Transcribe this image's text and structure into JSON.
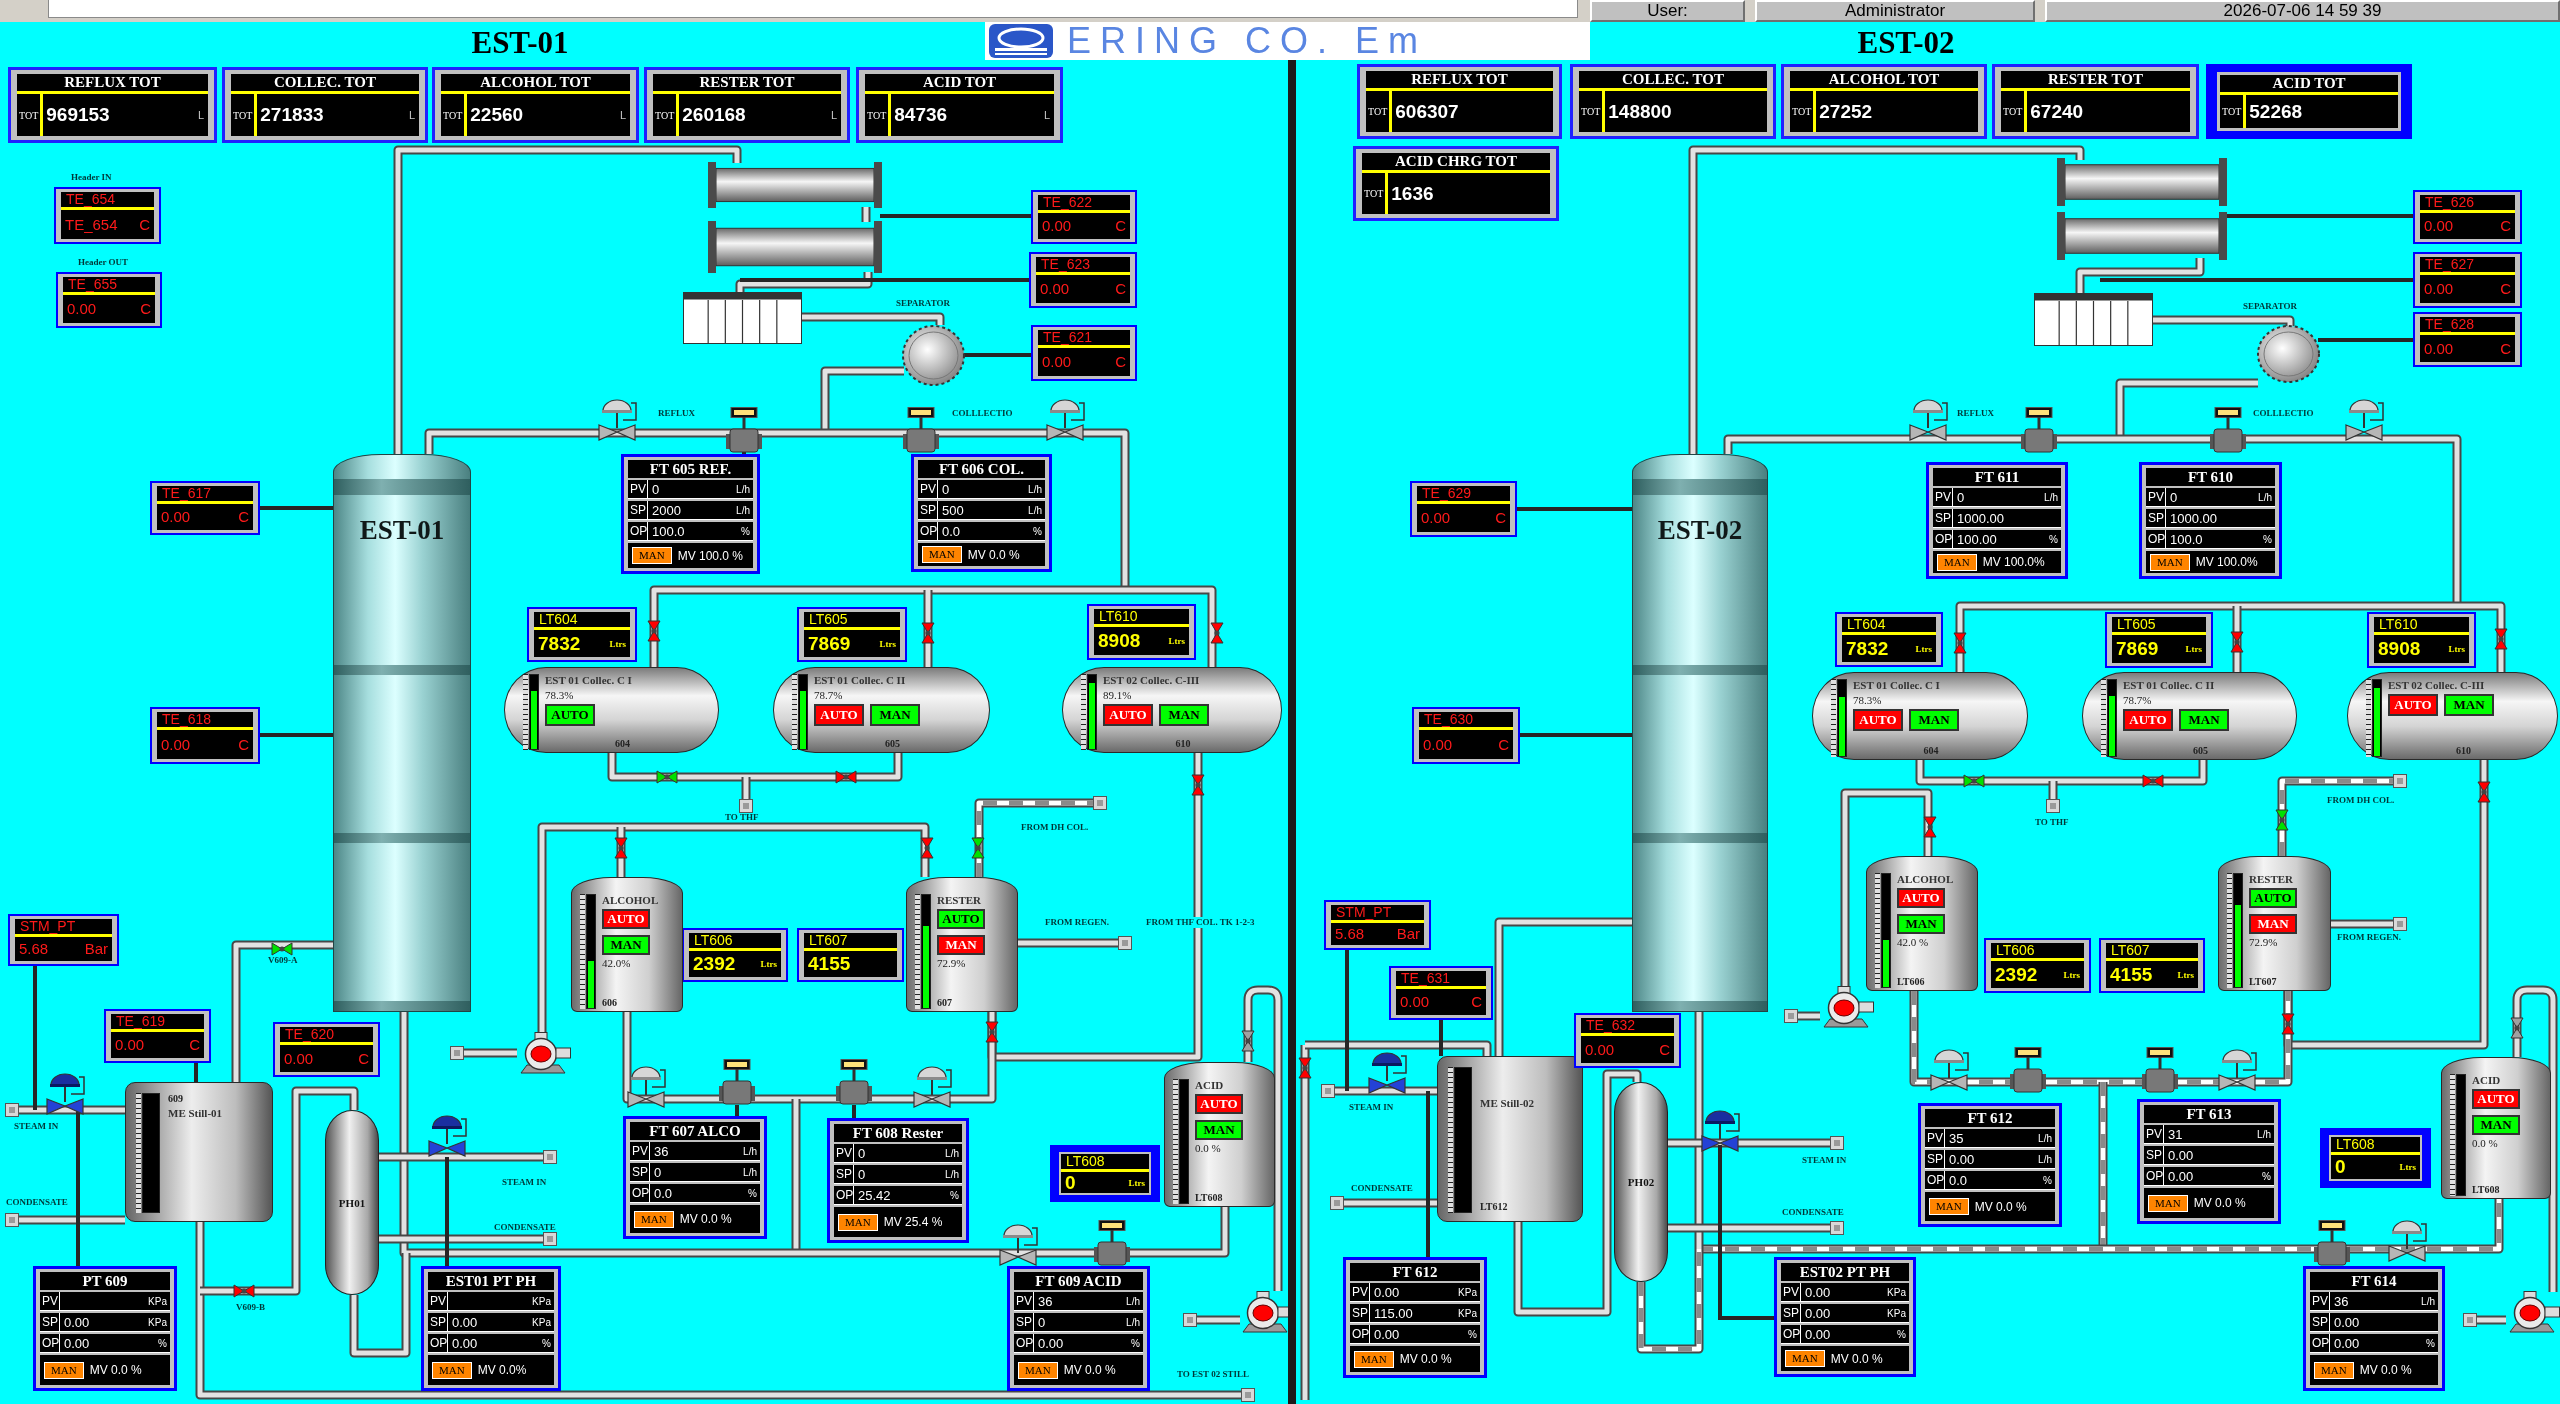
{
  "top_bar": {
    "user_label": "User:",
    "user": "Administrator",
    "datetime": "2026-07-06 14 59 39"
  },
  "logo": {
    "text": "ERING CO. Em"
  },
  "sections": [
    {
      "title": "EST-01",
      "totalizers": [
        {
          "title": "REFLUX TOT",
          "label": "TOT",
          "value": "969153",
          "unit": "L",
          "highlighted": false
        },
        {
          "title": "COLLEC. TOT",
          "label": "TOT",
          "value": "271833",
          "unit": "L",
          "highlighted": false
        },
        {
          "title": "ALCOHOL TOT",
          "label": "TOT",
          "value": "22560",
          "unit": "L",
          "highlighted": false
        },
        {
          "title": "RESTER TOT",
          "label": "TOT",
          "value": "260168",
          "unit": "L",
          "highlighted": false
        },
        {
          "title": "ACID TOT",
          "label": "TOT",
          "value": "84736",
          "unit": "L",
          "highlighted": false
        }
      ],
      "temperatures": [
        {
          "tag": "TE_654",
          "reading": "TE_654",
          "unit": "C"
        },
        {
          "tag": "TE_655",
          "reading": "0.00",
          "unit": "C"
        },
        {
          "tag": "TE_622",
          "reading": "0.00",
          "unit": "C"
        },
        {
          "tag": "TE_623",
          "reading": "0.00",
          "unit": "C"
        },
        {
          "tag": "TE_621",
          "reading": "0.00",
          "unit": "C"
        },
        {
          "tag": "TE_617",
          "reading": "0.00",
          "unit": "C"
        },
        {
          "tag": "TE_618",
          "reading": "0.00",
          "unit": "C"
        },
        {
          "tag": "STM_PT",
          "reading": "5.68",
          "unit": "Bar"
        },
        {
          "tag": "TE_619",
          "reading": "0.00",
          "unit": "C"
        },
        {
          "tag": "TE_620",
          "reading": "0.00",
          "unit": "C"
        }
      ],
      "level_displays": [
        {
          "tag": "LT604",
          "value": "7832",
          "unit": "Ltrs",
          "highlighted": false
        },
        {
          "tag": "LT605",
          "value": "7869",
          "unit": "Ltrs",
          "highlighted": false
        },
        {
          "tag": "LT610",
          "value": "8908",
          "unit": "Ltrs",
          "highlighted": false
        },
        {
          "tag": "LT606",
          "value": "2392",
          "unit": "Ltrs",
          "highlighted": false
        },
        {
          "tag": "LT607",
          "value": "4155",
          "highlighted": false
        },
        {
          "tag": "LT608",
          "value": "0",
          "unit": "Ltrs",
          "highlighted": true
        }
      ],
      "column": {
        "label": "EST-01"
      },
      "receivers": [
        {
          "name": "EST 01 Collec. C I",
          "percent": "78.3%",
          "level": 0.783,
          "tag": "604",
          "buttons": [
            {
              "label": "AUTO",
              "on": true
            }
          ]
        },
        {
          "name": "EST 01 Collec. C II",
          "percent": "78.7%",
          "level": 0.787,
          "tag": "605",
          "buttons": [
            {
              "label": "AUTO",
              "on": false
            },
            {
              "label": "MAN",
              "on": true
            }
          ]
        },
        {
          "name": "EST 02 Collec. C-III",
          "percent": "89.1%",
          "level": 0.891,
          "tag": "610",
          "buttons": [
            {
              "label": "AUTO",
              "on": false
            },
            {
              "label": "MAN",
              "on": true
            }
          ]
        }
      ],
      "vessels": [
        {
          "name": "ALCOHOL",
          "percent": "42.0%",
          "level": 0.42,
          "tag": "606",
          "buttons": [
            {
              "label": "AUTO",
              "on": false
            },
            {
              "label": "MAN",
              "on": true
            }
          ]
        },
        {
          "name": "RESTER",
          "percent": "72.9%",
          "level": 0.729,
          "tag": "607",
          "buttons": [
            {
              "label": "AUTO",
              "on": true
            },
            {
              "label": "MAN",
              "on": false
            }
          ]
        },
        {
          "name": "ACID",
          "percent": "0.0 %",
          "tag": "LT608",
          "buttons": [
            {
              "label": "AUTO",
              "on": false
            },
            {
              "label": "MAN",
              "on": true
            }
          ]
        }
      ],
      "still": {
        "name": "ME Still-01",
        "tag": "609"
      },
      "preheater": {
        "label": "PH01"
      },
      "faceplates": [
        {
          "title": "FT 605 REF.",
          "rows": [
            {
              "label": "PV",
              "value": "0",
              "unit": "L/h"
            },
            {
              "label": "SP",
              "value": "2000",
              "unit": "L/h"
            },
            {
              "label": "OP",
              "value": "100.0",
              "unit": "%"
            }
          ],
          "mode": "MAN",
          "mv": "MV 100.0 %"
        },
        {
          "title": "FT 606 COL.",
          "rows": [
            {
              "label": "PV",
              "value": "0",
              "unit": "L/h"
            },
            {
              "label": "SP",
              "value": "500",
              "unit": "L/h"
            },
            {
              "label": "OP",
              "value": "0.0",
              "unit": "%"
            }
          ],
          "mode": "MAN",
          "mv": "MV 0.0 %"
        },
        {
          "title": "FT 607 ALCO",
          "rows": [
            {
              "label": "PV",
              "value": "36",
              "unit": "L/h"
            },
            {
              "label": "SP",
              "value": "0",
              "unit": "L/h"
            },
            {
              "label": "OP",
              "value": "0.0",
              "unit": "%"
            }
          ],
          "mode": "MAN",
          "mv": "MV 0.0 %"
        },
        {
          "title": "FT 608 Rester",
          "rows": [
            {
              "label": "PV",
              "value": "0",
              "unit": "L/h"
            },
            {
              "label": "SP",
              "value": "0",
              "unit": "L/h"
            },
            {
              "label": "OP",
              "value": "25.42",
              "unit": "%"
            }
          ],
          "mode": "MAN",
          "mv": "MV 25.4 %"
        },
        {
          "title": "PT 609",
          "rows": [
            {
              "label": "PV",
              "unit": "KPa"
            },
            {
              "label": "SP",
              "value": "0.00",
              "unit": "KPa"
            },
            {
              "label": "OP",
              "value": "0.00",
              "unit": "%"
            }
          ],
          "mode": "MAN",
          "mv": "MV 0.0 %"
        },
        {
          "title": "EST01 PT PH",
          "rows": [
            {
              "label": "PV",
              "unit": "KPa"
            },
            {
              "label": "SP",
              "value": "0.00",
              "unit": "KPa"
            },
            {
              "label": "OP",
              "value": "0.00",
              "unit": "%"
            }
          ],
          "mode": "MAN",
          "mv": "MV 0.0%"
        },
        {
          "title": "FT 609 ACID",
          "rows": [
            {
              "label": "PV",
              "value": "36",
              "unit": "L/h"
            },
            {
              "label": "SP",
              "value": "0",
              "unit": "L/h"
            },
            {
              "label": "OP",
              "value": "0.00",
              "unit": "%"
            }
          ],
          "mode": "MAN",
          "mv": "MV 0.0 %"
        }
      ],
      "labels": [
        "Header IN",
        "Header OUT",
        "SEPARATOR",
        "REFLUX",
        "COLLLECTIO",
        "TO THF",
        "FROM DH COL.",
        "FROM REGEN.",
        "FROM THF COL. TK 1-2-3",
        "STEAM IN",
        "CONDENSATE",
        "STEAM IN",
        "CONDENSATE",
        "V609-A",
        "V609-B",
        "TO EST 02 STILL"
      ],
      "valves": [
        {
          "open": false
        },
        {
          "open": false
        },
        {
          "open": false
        },
        {
          "open": true
        },
        {
          "open": false
        },
        {
          "open": false
        },
        {
          "open": false
        },
        {
          "open": false
        },
        {
          "open": true
        },
        {
          "open": true
        },
        {
          "open": false
        },
        {
          "open": false
        }
      ]
    },
    {
      "title": "EST-02",
      "totalizers": [
        {
          "title": "REFLUX TOT",
          "label": "TOT",
          "value": "606307",
          "highlighted": false
        },
        {
          "title": "COLLEC. TOT",
          "label": "TOT",
          "value": "148800",
          "highlighted": false
        },
        {
          "title": "ALCOHOL TOT",
          "label": "TOT",
          "value": "27252",
          "highlighted": false
        },
        {
          "title": "RESTER TOT",
          "label": "TOT",
          "value": "67240",
          "highlighted": false
        },
        {
          "title": "ACID TOT",
          "label": "TOT",
          "value": "52268",
          "highlighted": true
        },
        {
          "title": "ACID CHRG TOT",
          "label": "TOT",
          "value": "1636",
          "highlighted": false
        }
      ],
      "temperatures": [
        {
          "tag": "TE_626",
          "reading": "0.00",
          "unit": "C"
        },
        {
          "tag": "TE_627",
          "reading": "0.00",
          "unit": "C"
        },
        {
          "tag": "TE_628",
          "reading": "0.00",
          "unit": "C"
        },
        {
          "tag": "TE_629",
          "reading": "0.00",
          "unit": "C"
        },
        {
          "tag": "TE_630",
          "reading": "0.00",
          "unit": "C"
        },
        {
          "tag": "STM_PT",
          "reading": "5.68",
          "unit": "Bar"
        },
        {
          "tag": "TE_631",
          "reading": "0.00",
          "unit": "C"
        },
        {
          "tag": "TE_632",
          "reading": "0.00",
          "unit": "C"
        }
      ],
      "level_displays": [
        {
          "tag": "LT604",
          "value": "7832",
          "unit": "Ltrs",
          "highlighted": false
        },
        {
          "tag": "LT605",
          "value": "7869",
          "unit": "Ltrs",
          "highlighted": false
        },
        {
          "tag": "LT610",
          "value": "8908",
          "unit": "Ltrs",
          "highlighted": false
        },
        {
          "tag": "LT606",
          "value": "2392",
          "unit": "Ltrs",
          "highlighted": false
        },
        {
          "tag": "LT607",
          "value": "4155",
          "unit": "Ltrs",
          "highlighted": false
        },
        {
          "tag": "LT608",
          "value": "0",
          "unit": "Ltrs",
          "highlighted": true
        }
      ],
      "column": {
        "label": "EST-02"
      },
      "receivers": [
        {
          "name": "EST 01 Collec. C I",
          "percent": "78.3%",
          "level": 0.783,
          "tag": "604",
          "buttons": [
            {
              "label": "AUTO",
              "on": false
            },
            {
              "label": "MAN",
              "on": true
            }
          ]
        },
        {
          "name": "EST 01 Collec. C II",
          "percent": "78.7%",
          "level": 0.787,
          "tag": "605",
          "buttons": [
            {
              "label": "AUTO",
              "on": false
            },
            {
              "label": "MAN",
              "on": true
            }
          ]
        },
        {
          "name": "EST 02 Collec. C-III",
          "level": 0.891,
          "tag": "610",
          "buttons": [
            {
              "label": "AUTO",
              "on": false
            },
            {
              "label": "MAN",
              "on": true
            }
          ]
        }
      ],
      "vessels": [
        {
          "name": "ALCOHOL",
          "percent": "42.0 %",
          "level": 0.42,
          "tag": "LT606",
          "buttons": [
            {
              "label": "AUTO",
              "on": false
            },
            {
              "label": "MAN",
              "on": true
            }
          ]
        },
        {
          "name": "RESTER",
          "percent": "72.9%",
          "level": 0.729,
          "tag": "LT607",
          "buttons": [
            {
              "label": "AUTO",
              "on": true
            },
            {
              "label": "MAN",
              "on": false
            }
          ]
        },
        {
          "name": "ACID",
          "percent": "0.0 %",
          "tag": "LT608",
          "buttons": [
            {
              "label": "AUTO",
              "on": false
            },
            {
              "label": "MAN",
              "on": true
            }
          ]
        }
      ],
      "still": {
        "name": "ME Still-02",
        "tag": "LT612"
      },
      "preheater": {
        "label": "PH02"
      },
      "faceplates": [
        {
          "title": "FT 611",
          "rows": [
            {
              "label": "PV",
              "value": "0",
              "unit": "L/h"
            },
            {
              "label": "SP",
              "value": "1000.00"
            },
            {
              "label": "OP",
              "value": "100.00",
              "unit": "%"
            }
          ],
          "mode": "MAN",
          "mv": "MV 100.0%"
        },
        {
          "title": "FT 610",
          "rows": [
            {
              "label": "PV",
              "value": "0",
              "unit": "L/h"
            },
            {
              "label": "SP",
              "value": "1000.00"
            },
            {
              "label": "OP",
              "value": "100.0",
              "unit": "%"
            }
          ],
          "mode": "MAN",
          "mv": "MV 100.0%"
        },
        {
          "title": "FT 612",
          "rows": [
            {
              "label": "PV",
              "value": "35",
              "unit": "L/h"
            },
            {
              "label": "SP",
              "value": "0.00",
              "unit": "L/h"
            },
            {
              "label": "OP",
              "value": "0.0",
              "unit": "%"
            }
          ],
          "mode": "MAN",
          "mv": "MV 0.0 %"
        },
        {
          "title": "FT 613",
          "rows": [
            {
              "label": "PV",
              "value": "31",
              "unit": "L/h"
            },
            {
              "label": "SP",
              "value": "0.00"
            },
            {
              "label": "OP",
              "value": "0.00",
              "unit": "%"
            }
          ],
          "mode": "MAN",
          "mv": "MV 0.0 %"
        },
        {
          "title": "FT 612",
          "rows": [
            {
              "label": "PV",
              "value": "0.00",
              "unit": "KPa"
            },
            {
              "label": "SP",
              "value": "115.00",
              "unit": "KPa"
            },
            {
              "label": "OP",
              "value": "0.00",
              "unit": "%"
            }
          ],
          "mode": "MAN",
          "mv": "MV 0.0 %"
        },
        {
          "title": "EST02 PT PH",
          "rows": [
            {
              "label": "PV",
              "value": "0.00",
              "unit": "KPa"
            },
            {
              "label": "SP",
              "value": "0.00",
              "unit": "KPa"
            },
            {
              "label": "OP",
              "value": "0.00",
              "unit": "%"
            }
          ],
          "mode": "MAN",
          "mv": "MV 0.0 %"
        },
        {
          "title": "FT 614",
          "rows": [
            {
              "label": "PV",
              "value": "36",
              "unit": "L/h"
            },
            {
              "label": "SP",
              "value": "0.00"
            },
            {
              "label": "OP",
              "value": "0.00",
              "unit": "%"
            }
          ],
          "mode": "MAN",
          "mv": "MV 0.0 %"
        }
      ],
      "labels": [
        "SEPARATOR",
        "REFLUX",
        "COLLLECTIO",
        "TO THF",
        "FROM DH COL.",
        "FROM REGEN.",
        "STEAM IN",
        "CONDENSATE",
        "STEAM IN",
        "CONDENSATE"
      ],
      "valves": [
        {
          "open": false
        },
        {
          "open": false
        },
        {
          "open": false
        },
        {
          "open": true
        },
        {
          "open": false
        },
        {
          "open": false
        },
        {
          "open": false
        },
        {
          "open": true
        },
        {
          "open": false
        },
        {
          "open": false
        }
      ]
    }
  ]
}
